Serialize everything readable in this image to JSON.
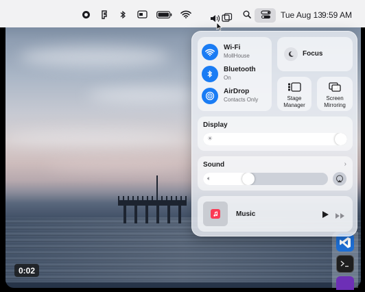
{
  "menubar": {
    "date": "Tue Aug 13",
    "time": "9:59 AM",
    "icons": [
      "record-icon",
      "figma-icon",
      "bluetooth-icon",
      "screen-icon",
      "battery-icon",
      "wifi-icon",
      "volume-icon",
      "window-icon",
      "spotlight-icon",
      "control-center-icon"
    ]
  },
  "video": {
    "timestamp": "0:02"
  },
  "control_center": {
    "wifi": {
      "title": "Wi-Fi",
      "subtitle": "MollHouse"
    },
    "bluetooth": {
      "title": "Bluetooth",
      "subtitle": "On"
    },
    "airdrop": {
      "title": "AirDrop",
      "subtitle": "Contacts Only"
    },
    "focus": {
      "label": "Focus"
    },
    "stage_manager": {
      "label_line1": "Stage",
      "label_line2": "Manager"
    },
    "screen_mirroring": {
      "label_line1": "Screen",
      "label_line2": "Mirroring"
    },
    "display": {
      "title": "Display",
      "level": 0.98
    },
    "sound": {
      "title": "Sound",
      "level": 0.36
    },
    "music": {
      "title": "Music"
    }
  },
  "colors": {
    "accent": "#1a7cf4",
    "menubar_bg": "#f2f2f3"
  }
}
